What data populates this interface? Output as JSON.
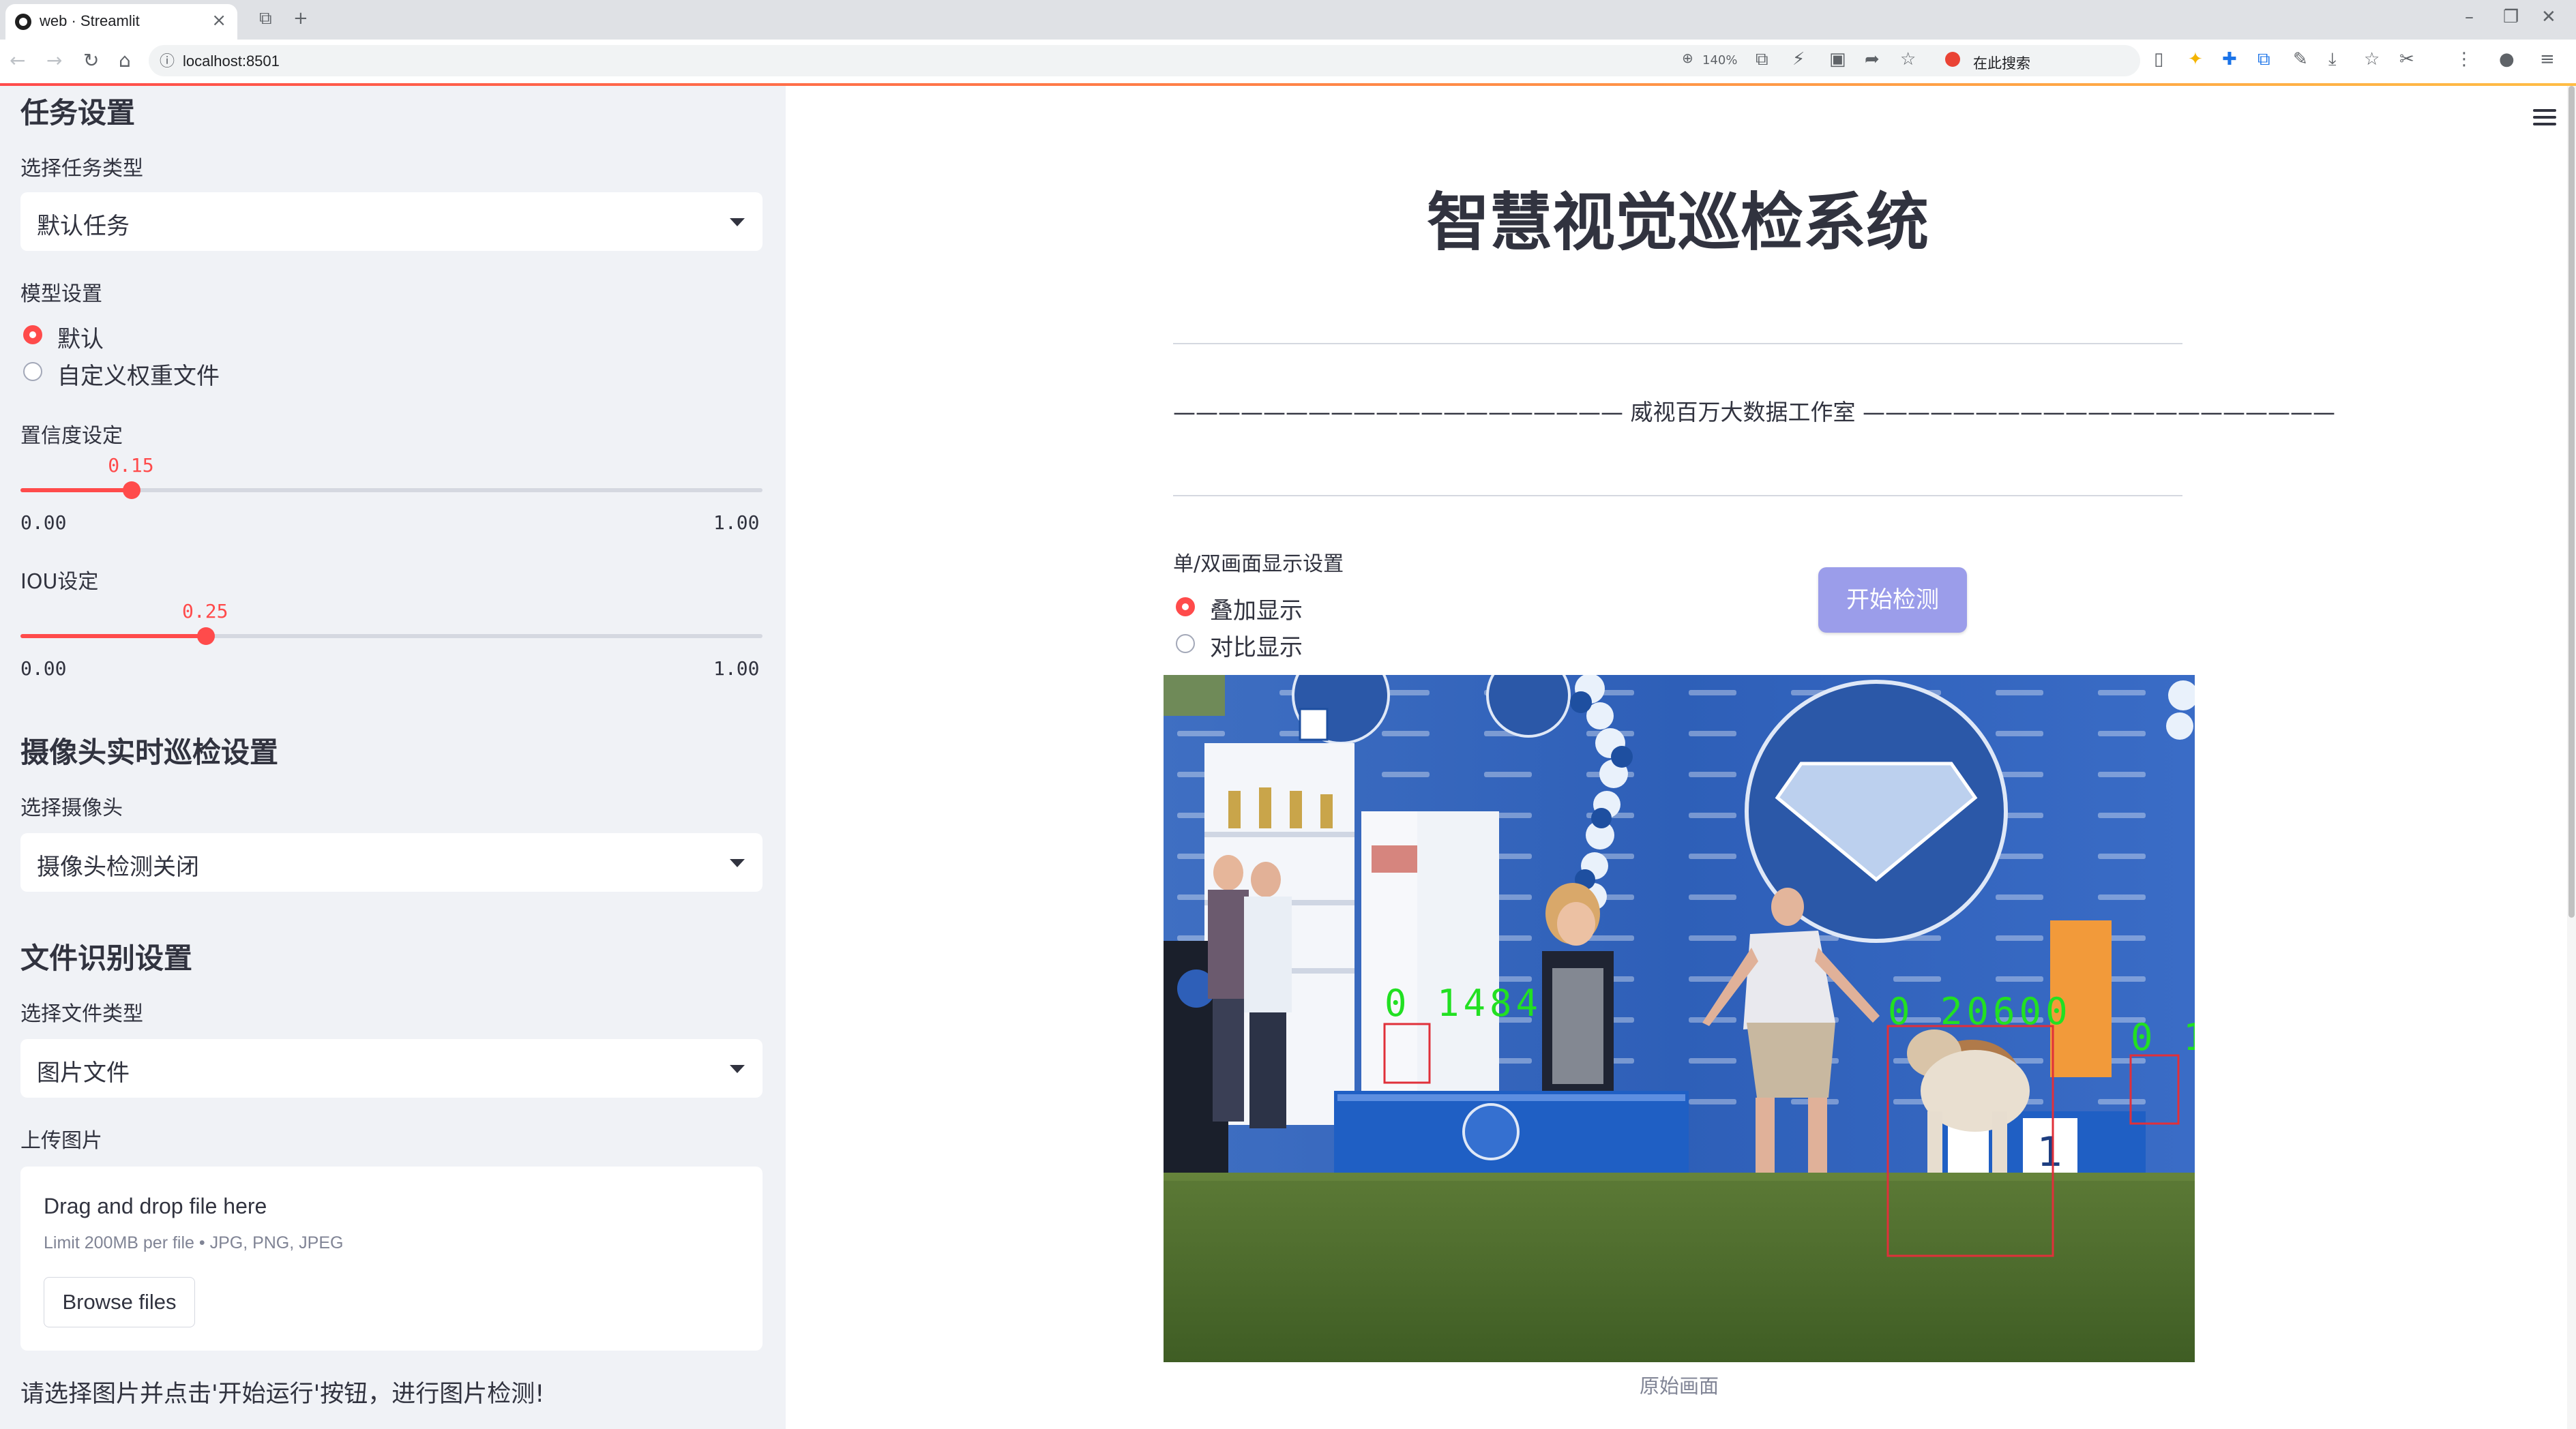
{
  "browser": {
    "tab_title": "web · Streamlit",
    "url": "localhost:8501",
    "zoom": "140%",
    "search_label": "在此搜索"
  },
  "sidebar": {
    "task_section": "任务设置",
    "task_type_label": "选择任务类型",
    "task_type_value": "默认任务",
    "model_label": "模型设置",
    "model_options": [
      "默认",
      "自定义权重文件"
    ],
    "model_selected": 0,
    "confidence_label": "置信度设定",
    "confidence": {
      "value": "0.15",
      "min": "0.00",
      "max": "1.00",
      "fraction": 0.15
    },
    "iou_label": "IOU设定",
    "iou": {
      "value": "0.25",
      "min": "0.00",
      "max": "1.00",
      "fraction": 0.25
    },
    "camera_section": "摄像头实时巡检设置",
    "camera_label": "选择摄像头",
    "camera_value": "摄像头检测关闭",
    "file_section": "文件识别设置",
    "file_type_label": "选择文件类型",
    "file_type_value": "图片文件",
    "upload_label": "上传图片",
    "dropzone_title": "Drag and drop file here",
    "dropzone_sub": "Limit 200MB per file • JPG, PNG, JPEG",
    "browse_button": "Browse files",
    "note": "请选择图片并点击'开始运行'按钮，进行图片检测!"
  },
  "main": {
    "title": "智慧视觉巡检系统",
    "studio_line": "———————————————————— 威视百万大数据工作室 —————————————————————",
    "display_mode_label": "单/双画面显示设置",
    "display_options": [
      "叠加显示",
      "对比显示"
    ],
    "display_selected": 0,
    "start_button": "开始检测",
    "detections": [
      "0 1484",
      "0 20600",
      "0 1"
    ],
    "caption": "原始画面"
  },
  "colors": {
    "accent": "#ff4b4b",
    "button": "#9b9dea",
    "sidebar_bg": "#f0f2f6",
    "detection_label": "#22e022",
    "detection_box": "#e0303a"
  }
}
